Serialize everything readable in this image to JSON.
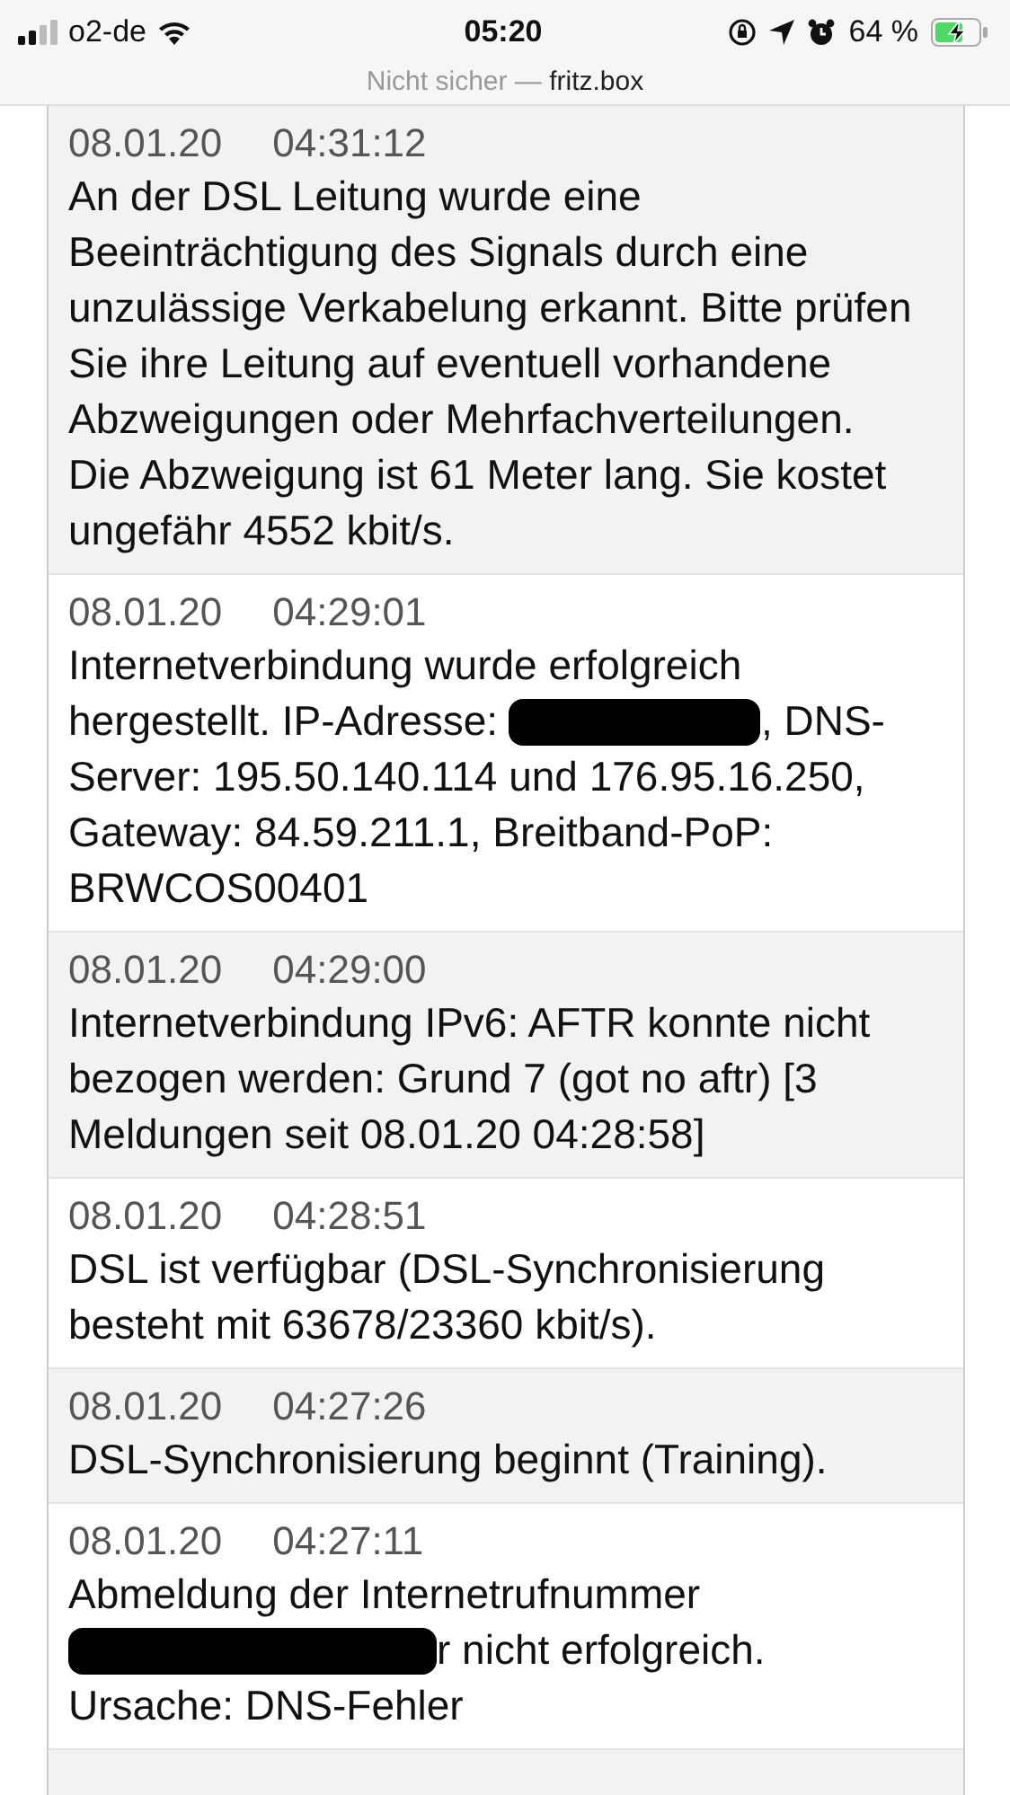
{
  "status_bar": {
    "carrier": "o2-de",
    "time": "05:20",
    "battery_percent": "64 %",
    "charging": true
  },
  "address_bar": {
    "security": "Nicht sicher —",
    "host": "fritz.box"
  },
  "events": [
    {
      "date": "08.01.20",
      "time": "04:31:12",
      "message": [
        {
          "kind": "text",
          "text": "An der DSL Leitung wurde eine Beeinträchtigung des Signals durch eine unzulässige Verkabelung erkannt. Bitte prüfen Sie ihre Leitung auf eventuell vorhandene Abzweigungen oder Mehrfachverteilungen. Die Abzweigung ist 61 Meter lang. Sie kostet ungefähr 4552 kbit/s."
        }
      ]
    },
    {
      "date": "08.01.20",
      "time": "04:29:01",
      "message": [
        {
          "kind": "text",
          "text": "Internetverbindung wurde erfolgreich hergestellt. IP-Adresse: "
        },
        {
          "kind": "redaction"
        },
        {
          "kind": "text",
          "text": ", DNS-Server: 195.50.140.114 und 176.95.16.250, Gateway: 84.59.211.1, Breitband-PoP: BRWCOS00401"
        }
      ]
    },
    {
      "date": "08.01.20",
      "time": "04:29:00",
      "message": [
        {
          "kind": "text",
          "text": "Internetverbindung IPv6: AFTR konnte nicht bezogen werden: Grund 7 (got no aftr) [3 Meldungen seit 08.01.20 04:28:58]"
        }
      ]
    },
    {
      "date": "08.01.20",
      "time": "04:28:51",
      "message": [
        {
          "kind": "text",
          "text": "DSL ist verfügbar (DSL-Synchronisierung besteht mit 63678/23360 kbit/s)."
        }
      ]
    },
    {
      "date": "08.01.20",
      "time": "04:27:26",
      "message": [
        {
          "kind": "text",
          "text": "DSL-Synchronisierung beginnt (Training)."
        }
      ]
    },
    {
      "date": "08.01.20",
      "time": "04:27:11",
      "message": [
        {
          "kind": "text",
          "text": "Abmeldung der Internetrufnummer "
        },
        {
          "kind": "redaction"
        },
        {
          "kind": "text",
          "text": "r nicht erfolgreich. Ursache: DNS-Fehler"
        }
      ]
    }
  ]
}
